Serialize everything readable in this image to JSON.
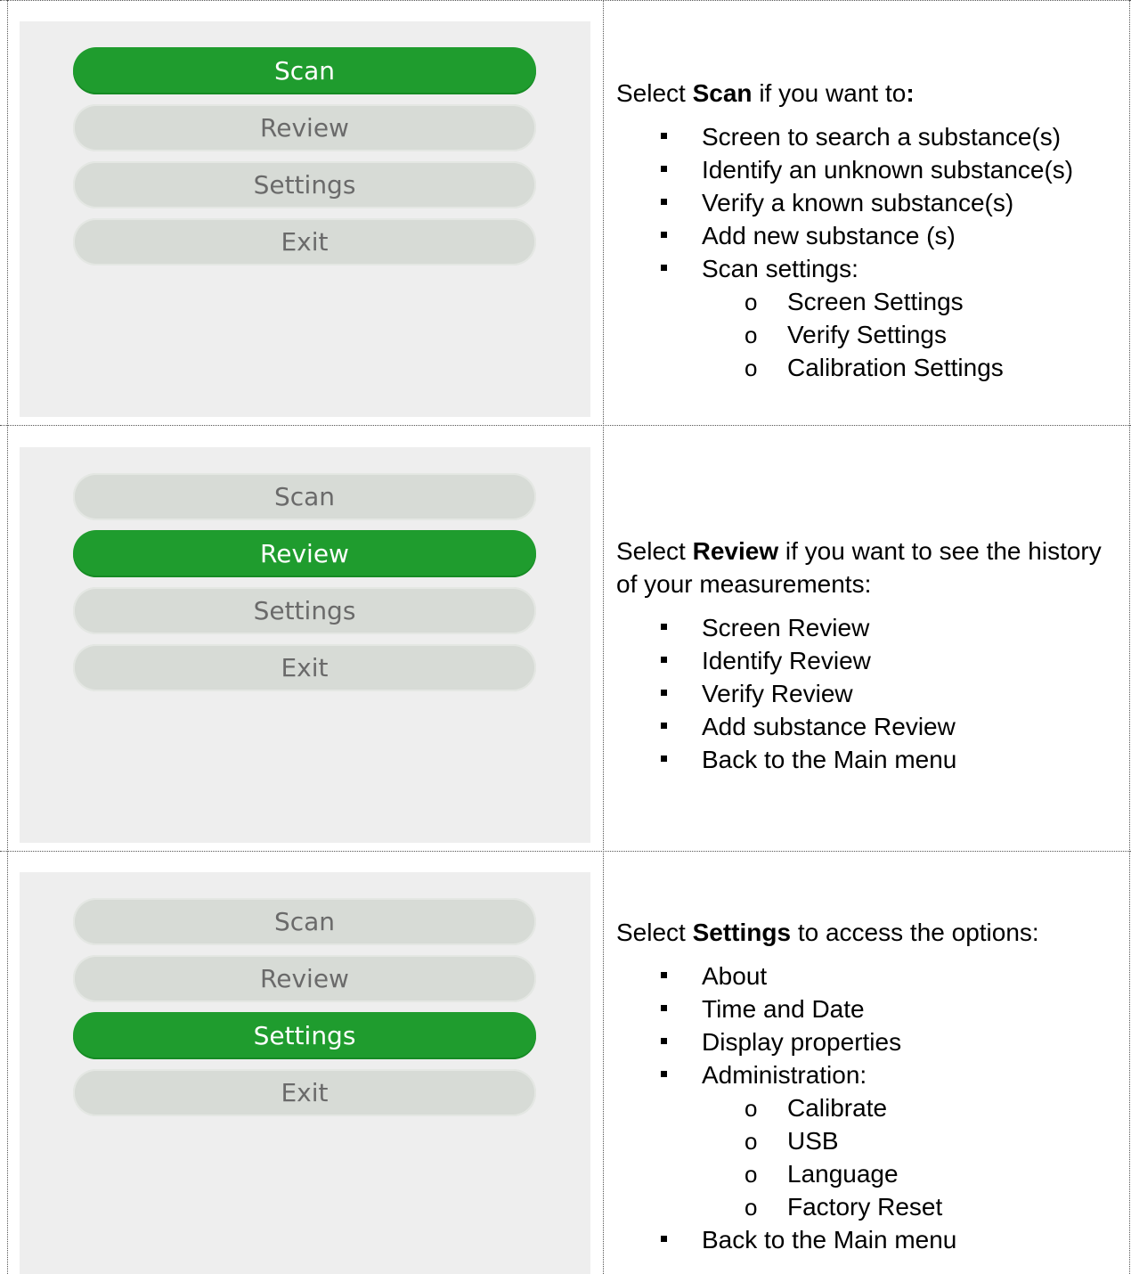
{
  "rows": [
    {
      "menu": {
        "scan": "Scan",
        "review": "Review",
        "settings": "Settings",
        "exit": "Exit",
        "active": "scan"
      },
      "lead_pre": "Select ",
      "lead_bold": "Scan",
      "lead_post": " if you want to",
      "lead_colon": ":",
      "bullets": [
        "Screen to search a substance(s)",
        "Identify an unknown substance(s)",
        "Verify a known substance(s)",
        "Add new substance (s)",
        "Scan settings:"
      ],
      "sub_marker": "o",
      "sub_bullets": [
        "Screen Settings",
        "Verify Settings",
        "Calibration Settings"
      ]
    },
    {
      "menu": {
        "scan": "Scan",
        "review": "Review",
        "settings": "Settings",
        "exit": "Exit",
        "active": "review"
      },
      "lead_pre": "Select ",
      "lead_bold": "Review",
      "lead_post": " if you want to see the history of your measurements:",
      "bullets": [
        "Screen Review",
        "Identify Review",
        "Verify Review",
        "Add substance Review",
        "Back to the Main menu"
      ]
    },
    {
      "menu": {
        "scan": "Scan",
        "review": "Review",
        "settings": "Settings",
        "exit": "Exit",
        "active": "settings"
      },
      "lead_pre": "Select ",
      "lead_bold": "Settings",
      "lead_post": " to access the options:",
      "bullets": [
        "About",
        "Time and Date",
        "Display properties",
        "Administration:"
      ],
      "sub_marker": "o",
      "sub_bullets": [
        "Calibrate",
        "USB",
        "Language",
        "Factory Reset"
      ],
      "after_sub": "Back to the Main menu"
    }
  ],
  "colors": {
    "active_button": "#1f9c2e",
    "inactive_button": "#d7dbd6",
    "panel": "#eeeeee"
  },
  "icons": {
    "bullet": "square-bullet-icon",
    "sub_bullet": "circle-bullet-icon"
  }
}
